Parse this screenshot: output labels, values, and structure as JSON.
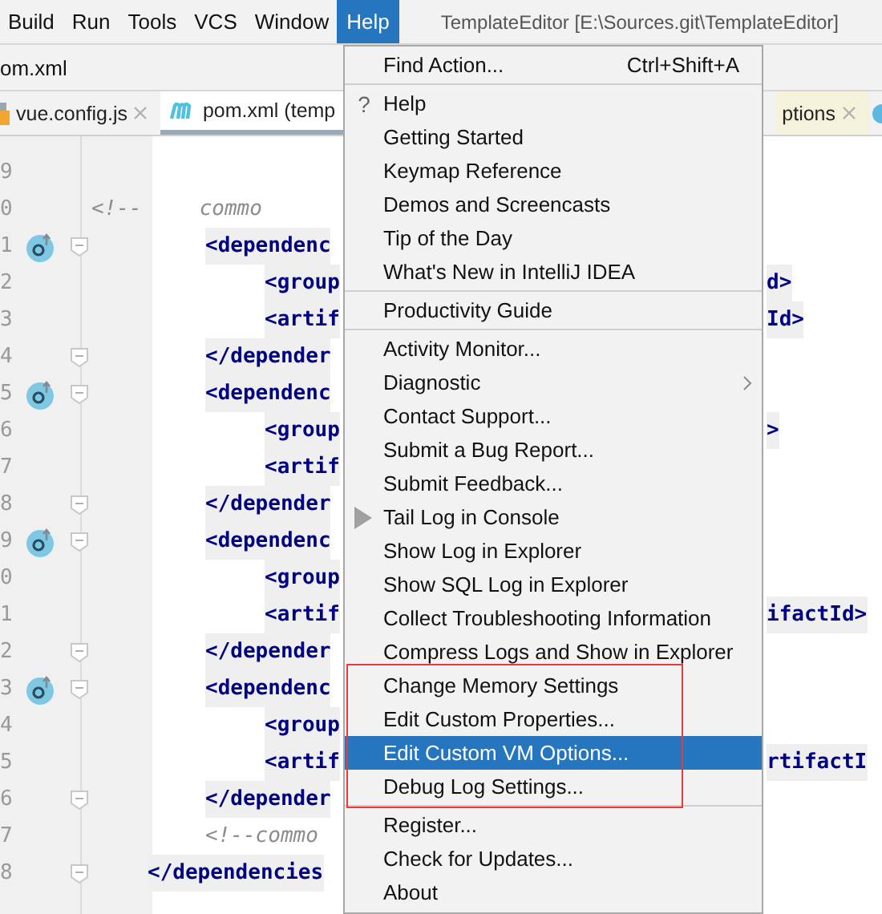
{
  "menubar": {
    "items": [
      {
        "label": "Build",
        "selected": false
      },
      {
        "label": "Run",
        "selected": false
      },
      {
        "label": "Tools",
        "selected": false
      },
      {
        "label": "VCS",
        "selected": false
      },
      {
        "label": "Window",
        "selected": false
      },
      {
        "label": "Help",
        "selected": true
      }
    ],
    "title": "TemplateEditor [E:\\Sources.git\\TemplateEditor]"
  },
  "breadcrumb": "om.xml",
  "tabs": [
    {
      "kind": "script",
      "label": "vue.config.js",
      "selected": false,
      "closable": true
    },
    {
      "kind": "maven",
      "label": "pom.xml (temp",
      "selected": true,
      "closable": false
    },
    {
      "kind": "plain",
      "label": "ptions",
      "selected": false,
      "closable": true
    },
    {
      "kind": "icon",
      "selected": false,
      "closable": false
    }
  ],
  "editor": {
    "lines": [
      {
        "number": "9",
        "kind": "blank",
        "gutter_icon": false,
        "fold": false
      },
      {
        "number": "0",
        "kind": "banner",
        "gutter_icon": false,
        "fold": false,
        "text": "<!--",
        "after": "commo"
      },
      {
        "number": "1",
        "kind": "open",
        "gutter_icon": true,
        "fold": true,
        "text": "<dependenc"
      },
      {
        "number": "2",
        "kind": "child",
        "gutter_icon": false,
        "fold": false,
        "text": "<group",
        "overflow": "d>"
      },
      {
        "number": "3",
        "kind": "child",
        "gutter_icon": false,
        "fold": false,
        "text": "<artif",
        "overflow": "Id>"
      },
      {
        "number": "4",
        "kind": "open",
        "gutter_icon": false,
        "fold": true,
        "text": "</depender"
      },
      {
        "number": "5",
        "kind": "open",
        "gutter_icon": true,
        "fold": true,
        "text": "<dependenc"
      },
      {
        "number": "6",
        "kind": "child",
        "gutter_icon": false,
        "fold": false,
        "text": "<group",
        "overflow": ">"
      },
      {
        "number": "7",
        "kind": "child",
        "gutter_icon": false,
        "fold": false,
        "text": "<artif"
      },
      {
        "number": "8",
        "kind": "open",
        "gutter_icon": false,
        "fold": true,
        "text": "</depender"
      },
      {
        "number": "9",
        "kind": "open",
        "gutter_icon": true,
        "fold": true,
        "text": "<dependenc"
      },
      {
        "number": "0",
        "kind": "child",
        "gutter_icon": false,
        "fold": false,
        "text": "<group"
      },
      {
        "number": "1",
        "kind": "child",
        "gutter_icon": false,
        "fold": false,
        "text": "<artif",
        "overflow": "ifactId>"
      },
      {
        "number": "2",
        "kind": "open",
        "gutter_icon": false,
        "fold": true,
        "text": "</depender"
      },
      {
        "number": "3",
        "kind": "open",
        "gutter_icon": true,
        "fold": true,
        "text": "<dependenc"
      },
      {
        "number": "4",
        "kind": "child",
        "gutter_icon": false,
        "fold": false,
        "text": "<group"
      },
      {
        "number": "5",
        "kind": "child",
        "gutter_icon": false,
        "fold": false,
        "text": "<artif",
        "overflow": "rtifactI"
      },
      {
        "number": "6",
        "kind": "open",
        "gutter_icon": false,
        "fold": true,
        "text": "</depender"
      },
      {
        "number": "7",
        "kind": "comment",
        "gutter_icon": false,
        "fold": false,
        "text": "<!--commo"
      },
      {
        "number": "8",
        "kind": "root",
        "gutter_icon": false,
        "fold": true,
        "text": "</dependencies"
      }
    ]
  },
  "help_menu": {
    "items": [
      {
        "kind": "item",
        "label": "Find Action...",
        "shortcut": "Ctrl+Shift+A",
        "selected": false,
        "boxed": false
      },
      {
        "kind": "separator"
      },
      {
        "kind": "item",
        "label": "Help",
        "glyph": "?",
        "selected": false,
        "boxed": false
      },
      {
        "kind": "item",
        "label": "Getting Started",
        "selected": false,
        "boxed": false
      },
      {
        "kind": "item",
        "label": "Keymap Reference",
        "selected": false,
        "boxed": false
      },
      {
        "kind": "item",
        "label": "Demos and Screencasts",
        "selected": false,
        "boxed": false
      },
      {
        "kind": "item",
        "label": "Tip of the Day",
        "selected": false,
        "boxed": false
      },
      {
        "kind": "item",
        "label": "What's New in IntelliJ IDEA",
        "selected": false,
        "boxed": false
      },
      {
        "kind": "separator"
      },
      {
        "kind": "item",
        "label": "Productivity Guide",
        "selected": false,
        "boxed": false
      },
      {
        "kind": "separator"
      },
      {
        "kind": "item",
        "label": "Activity Monitor...",
        "selected": false,
        "boxed": false
      },
      {
        "kind": "item",
        "label": "Diagnostic",
        "submenu": true,
        "selected": false,
        "boxed": false
      },
      {
        "kind": "item",
        "label": "Contact Support...",
        "selected": false,
        "boxed": false
      },
      {
        "kind": "item",
        "label": "Submit a Bug Report...",
        "selected": false,
        "boxed": false
      },
      {
        "kind": "item",
        "label": "Submit Feedback...",
        "selected": false,
        "boxed": false
      },
      {
        "kind": "action",
        "label": "Tail Log in Console",
        "selected": false,
        "boxed": false
      },
      {
        "kind": "item",
        "label": "Show Log in Explorer",
        "selected": false,
        "boxed": false
      },
      {
        "kind": "item",
        "label": "Show SQL Log in Explorer",
        "selected": false,
        "boxed": false
      },
      {
        "kind": "item",
        "label": "Collect Troubleshooting Information",
        "selected": false,
        "boxed": false
      },
      {
        "kind": "item",
        "label": "Compress Logs and Show in Explorer",
        "selected": false,
        "boxed": false
      },
      {
        "kind": "item",
        "label": "Change Memory Settings",
        "selected": false,
        "boxed": true
      },
      {
        "kind": "item",
        "label": "Edit Custom Properties...",
        "selected": false,
        "boxed": true
      },
      {
        "kind": "item",
        "label": "Edit Custom VM Options...",
        "selected": true,
        "boxed": true
      },
      {
        "kind": "item",
        "label": "Debug Log Settings...",
        "selected": false,
        "boxed": true
      },
      {
        "kind": "separator"
      },
      {
        "kind": "item",
        "label": "Register...",
        "selected": false,
        "boxed": false
      },
      {
        "kind": "item",
        "label": "Check for Updates...",
        "selected": false,
        "boxed": false
      },
      {
        "kind": "item",
        "label": "About",
        "selected": false,
        "boxed": false
      }
    ]
  }
}
